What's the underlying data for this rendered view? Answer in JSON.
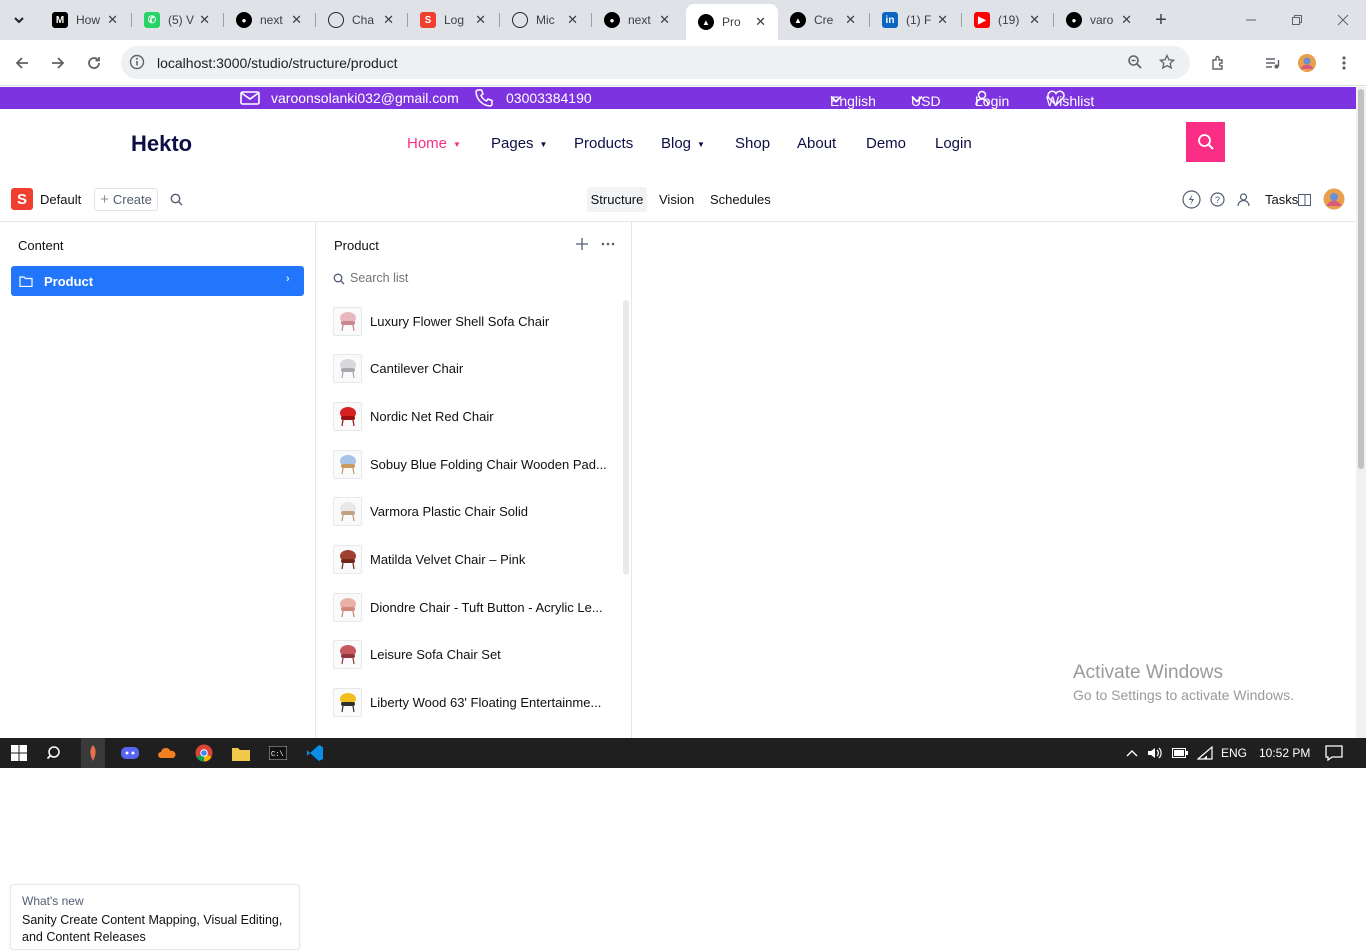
{
  "browser": {
    "tabs": [
      {
        "favicon": "M",
        "label": "How",
        "color": "#000000"
      },
      {
        "favicon": "wa",
        "label": "(5) V",
        "color": "#25d366"
      },
      {
        "favicon": "gh",
        "label": "next",
        "color": "#000000"
      },
      {
        "favicon": "gpt",
        "label": "Cha",
        "color": "#202124"
      },
      {
        "favicon": "S",
        "label": "Log",
        "color": "#f03e2f"
      },
      {
        "favicon": "gpt",
        "label": "Mic",
        "color": "#202124"
      },
      {
        "favicon": "gh",
        "label": "next",
        "color": "#000000"
      },
      {
        "favicon": "ntl",
        "label": "Pro",
        "color": "#000000"
      },
      {
        "favicon": "ntl",
        "label": "Cre",
        "color": "#000000"
      },
      {
        "favicon": "in",
        "label": "(1) F",
        "color": "#0a66c2"
      },
      {
        "favicon": "yt",
        "label": "(19)",
        "color": "#ff0000"
      },
      {
        "favicon": "gh",
        "label": "varo",
        "color": "#000000"
      }
    ],
    "url": "localhost:3000/studio/structure/product"
  },
  "site": {
    "email": "varoonsolanki032@gmail.com",
    "phone": "03003384190",
    "language": "English",
    "currency": "USD",
    "login": "Login",
    "wishlist": "Wishlist",
    "brand": "Hekto",
    "nav": [
      "Home",
      "Pages",
      "Products",
      "Blog",
      "Shop",
      "About",
      "Demo",
      "Login"
    ],
    "accent": "#fb2e86",
    "topbar_color": "#7e33e0"
  },
  "studio": {
    "workspace": "Default",
    "create": "Create",
    "tools": [
      "Structure",
      "Vision",
      "Schedules"
    ],
    "tasks": "Tasks",
    "content_title": "Content",
    "content_item": "Product",
    "product_title": "Product",
    "search_placeholder": "Search list",
    "products": [
      "Luxury Flower Shell Sofa Chair",
      "Cantilever Chair",
      "Nordic Net Red Chair",
      "Sobuy Blue Folding Chair Wooden Pad...",
      "Varmora Plastic Chair Solid",
      "Matilda Velvet Chair – Pink",
      "Diondre Chair - Tuft Button - Acrylic Le...",
      "Leisure Sofa Chair Set",
      "Liberty Wood 63' Floating Entertainme..."
    ],
    "whats_new_label": "What's new",
    "whats_new_text": "Sanity Create Content Mapping, Visual Editing, and Content Releases"
  },
  "windows": {
    "activate_title": "Activate Windows",
    "activate_sub": "Go to Settings to activate Windows.",
    "lang": "ENG",
    "time": "10:52 PM"
  }
}
